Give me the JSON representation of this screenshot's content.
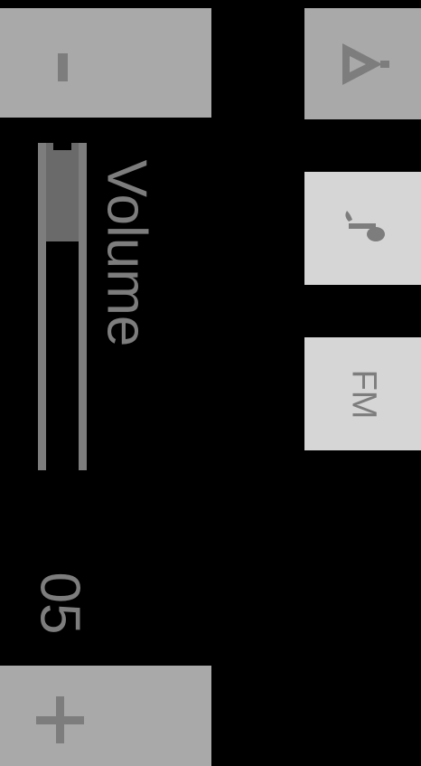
{
  "volume": {
    "label": "Volume",
    "value_text": "05",
    "level": 0.3,
    "decrease_label": "-",
    "increase_label": "+"
  },
  "side_buttons": [
    {
      "id": "alarm",
      "icon": "bell-icon"
    },
    {
      "id": "music",
      "icon": "music-note-icon"
    },
    {
      "id": "radio",
      "label": "FM"
    }
  ],
  "colors": {
    "background": "#000000",
    "button_dark": "#a9a9a9",
    "button_light": "#d6d6d6",
    "glyph": "#7d7d7d",
    "volume_fill": "#6a6a6a"
  }
}
